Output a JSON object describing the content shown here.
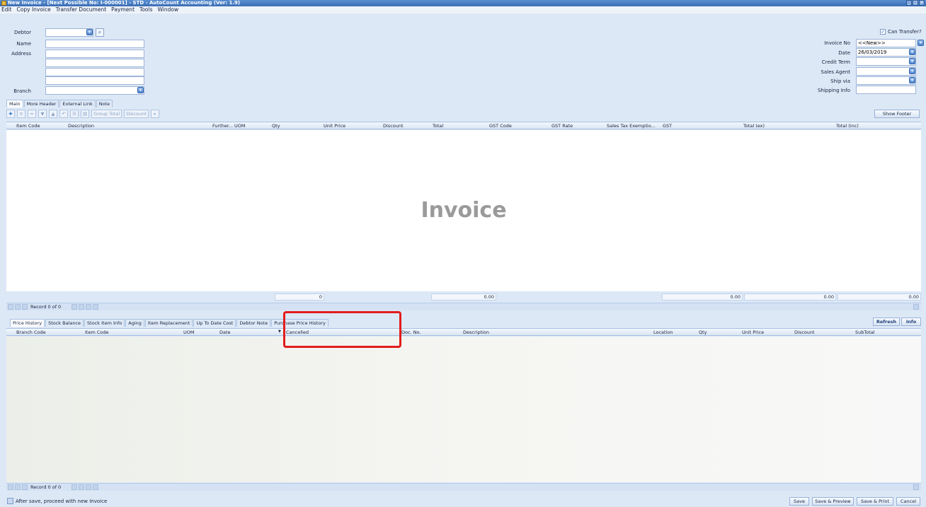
{
  "window": {
    "title": "New Invoice - [Next Possible No: I-000001] - STD - AutoCount Accounting (Ver: 1.9)",
    "controls": [
      "_",
      "□",
      "×"
    ]
  },
  "menu": [
    "Edit",
    "Copy Invoice",
    "Transfer Document",
    "Payment",
    "Tools",
    "Window"
  ],
  "header_left": {
    "debtor_label": "Debtor",
    "name_label": "Name",
    "address_label": "Address",
    "branch_label": "Branch",
    "debtor_value": "",
    "name_value": "",
    "branch_value": ""
  },
  "header_right": {
    "can_transfer_label": "Can Transfer?",
    "invoice_no_label": "Invoice No",
    "invoice_no_value": "<<New>>",
    "date_label": "Date",
    "date_value": "26/03/2019",
    "credit_term_label": "Credit Term",
    "sales_agent_label": "Sales Agent",
    "ship_via_label": "Ship via",
    "shipping_info_label": "Shipping Info"
  },
  "header_tabs": [
    "Main",
    "More Header",
    "External Link",
    "Note"
  ],
  "toolbar": {
    "group_total": "Group Total",
    "discount": "Discount",
    "show_footer": "Show Footer"
  },
  "item_grid": {
    "columns": [
      "Item Code",
      "Description",
      "Further...",
      "UOM",
      "Qty",
      "Unit Price",
      "Discount",
      "Total",
      "GST Code",
      "GST Rate",
      "Sales Tax Exemptio...",
      "GST",
      "Total (ex)",
      "Total (inc)"
    ],
    "watermark": "Invoice",
    "totals": {
      "qty": "0",
      "total": "0.00",
      "gst": "0.00",
      "total_ex": "0.00",
      "total_inc": "0.00"
    },
    "record_text": "Record 0 of 0"
  },
  "bottom_tabs": [
    "Price History",
    "Stock Balance",
    "Stock Item Info",
    "Aging",
    "Item Replacement",
    "Up To Date Cost",
    "Debtor Note",
    "Purchase Price History"
  ],
  "bottom_buttons": {
    "refresh": "Refresh",
    "info": "Info"
  },
  "history_grid": {
    "columns": [
      "Branch Code",
      "Item Code",
      "UOM",
      "Date",
      "Cancelled",
      "Doc. No.",
      "Description",
      "Location",
      "Qty",
      "Unit Price",
      "Discount",
      "SubTotal"
    ],
    "record_text": "Record 0 of 0"
  },
  "footer": {
    "after_save_label": "After save, proceed with new Invoice",
    "save": "Save",
    "save_preview": "Save & Preview",
    "save_print": "Save & Print",
    "cancel": "Cancel"
  },
  "colors": {
    "title_bar": "#3a6db5",
    "panel": "#dde8f6",
    "highlight": "#e21c1c",
    "accent_blue": "#4f86d2"
  }
}
